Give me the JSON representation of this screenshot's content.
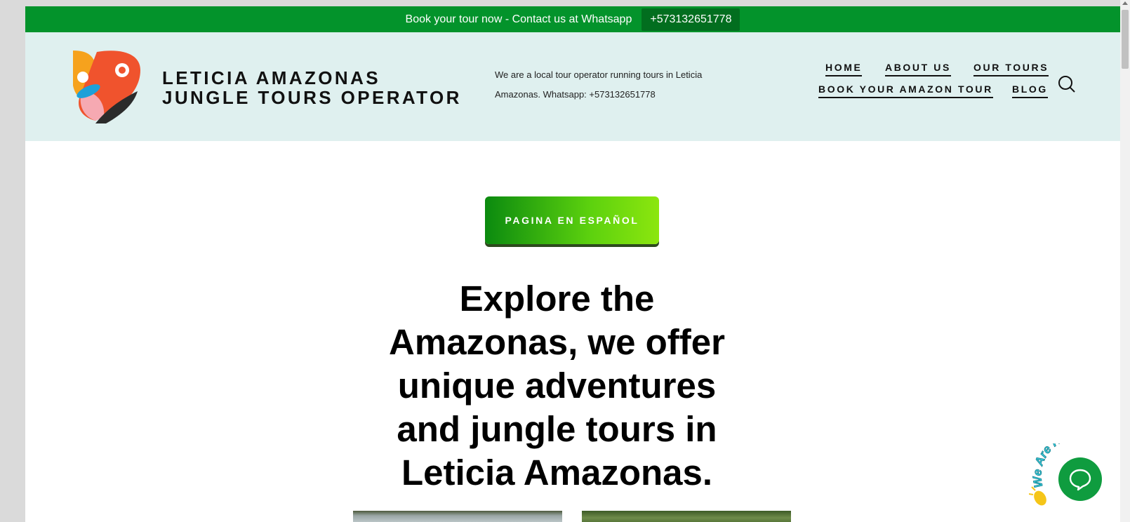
{
  "topbar": {
    "text": "Book your tour now - Contact us at Whatsapp",
    "phone_button": "+573132651778"
  },
  "header": {
    "site_title_line1": "LETICIA AMAZONAS",
    "site_title_line2": "JUNGLE TOURS OPERATOR",
    "tagline": "We are a local tour operator running tours in Leticia Amazonas. Whatsapp: +573132651778"
  },
  "nav": {
    "items": [
      "HOME",
      "ABOUT US",
      "OUR TOURS",
      "BOOK YOUR AMAZON TOUR",
      "BLOG"
    ]
  },
  "main": {
    "spanish_button": "PAGINA EN ESPAÑOL",
    "headline": "Explore the Amazonas, we offer unique adventures and jungle tours in Leticia Amazonas."
  },
  "chat": {
    "badge_text": "We Are Here!"
  },
  "colors": {
    "topbar_green": "#03932b",
    "header_bg": "#dff0ef",
    "chat_green": "#0f9c3f"
  }
}
